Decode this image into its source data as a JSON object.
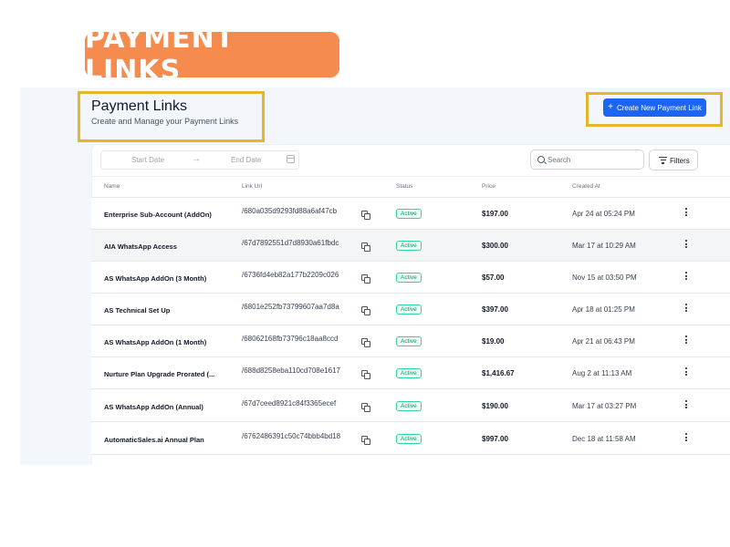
{
  "banner": {
    "label": "PAYMENT LINKS"
  },
  "header": {
    "title": "Payment Links",
    "subtitle": "Create and Manage your Payment Links",
    "create_label": "Create New Payment Link"
  },
  "filters": {
    "start_placeholder": "Start Date",
    "end_placeholder": "End Date",
    "search_placeholder": "Search",
    "filters_label": "Filters"
  },
  "table": {
    "columns": [
      "Name",
      "Link Url",
      "Status",
      "Price",
      "Created At"
    ],
    "rows": [
      {
        "name": "Enterprise Sub-Account (AddOn)",
        "url": "/680a035d9293fd88a6af47cb",
        "status": "Active",
        "price": "$197.00",
        "created": "Apr 24 at 05:24 PM"
      },
      {
        "name": "AIA WhatsApp Access",
        "url": "/67d7892551d7d8930a61fbdc",
        "status": "Active",
        "price": "$300.00",
        "created": "Mar 17 at 10:29 AM"
      },
      {
        "name": "AS WhatsApp AddOn (3 Month)",
        "url": "/6736fd4eb82a177b2209c026",
        "status": "Active",
        "price": "$57.00",
        "created": "Nov 15 at 03:50 PM"
      },
      {
        "name": "AS Technical Set Up",
        "url": "/6801e252fb73799607aa7d8a",
        "status": "Active",
        "price": "$397.00",
        "created": "Apr 18 at 01:25 PM"
      },
      {
        "name": "AS WhatsApp AddOn (1 Month)",
        "url": "/68062168fb73796c18aa8ccd",
        "status": "Active",
        "price": "$19.00",
        "created": "Apr 21 at 06:43 PM"
      },
      {
        "name": "Nurture Plan Upgrade Prorated (...",
        "url": "/688d8258eba110cd708e1617",
        "status": "Active",
        "price": "$1,416.67",
        "created": "Aug 2 at 11:13 AM"
      },
      {
        "name": "AS WhatsApp AddOn (Annual)",
        "url": "/67d7ceed8921c84f3365ecef",
        "status": "Active",
        "price": "$190.00",
        "created": "Mar 17 at 03:27 PM"
      },
      {
        "name": "AutomaticSales.ai Annual Plan",
        "url": "/6762486391c50c74bbb4bd18",
        "status": "Active",
        "price": "$997.00",
        "created": "Dec 18 at 11:58 AM"
      }
    ]
  },
  "colors": {
    "banner": "#f68b4f",
    "primary": "#1c64f2",
    "highlight_border": "#e5b62a",
    "active_green": "#059669"
  }
}
